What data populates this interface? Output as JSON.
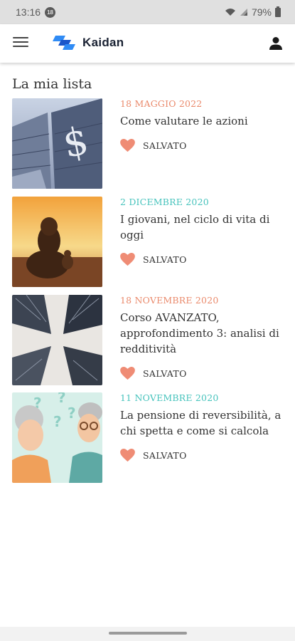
{
  "status_bar": {
    "time": "13:16",
    "notification_count": "18",
    "battery": "79%"
  },
  "app_bar": {
    "brand": "Kaidan"
  },
  "page": {
    "title": "La mia lista"
  },
  "colors": {
    "date_orange": "#ea8a6c",
    "date_teal": "#46c3bc",
    "heart": "#ef8c75"
  },
  "items": [
    {
      "date": "18 MAGGIO 2022",
      "date_color": "orange",
      "title": "Come valutare le azioni",
      "saved_label": "SALVATO"
    },
    {
      "date": "2 DICEMBRE 2020",
      "date_color": "teal",
      "title": "I giovani, nel ciclo di vita di oggi",
      "saved_label": "SALVATO"
    },
    {
      "date": "18 NOVEMBRE 2020",
      "date_color": "orange",
      "title": "Corso AVANZATO, approfondimento 3: analisi di redditività",
      "saved_label": "SALVATO"
    },
    {
      "date": "11 NOVEMBRE 2020",
      "date_color": "teal",
      "title": "La pensione di reversibilità, a chi spetta e come si calcola",
      "saved_label": "SALVATO"
    }
  ]
}
